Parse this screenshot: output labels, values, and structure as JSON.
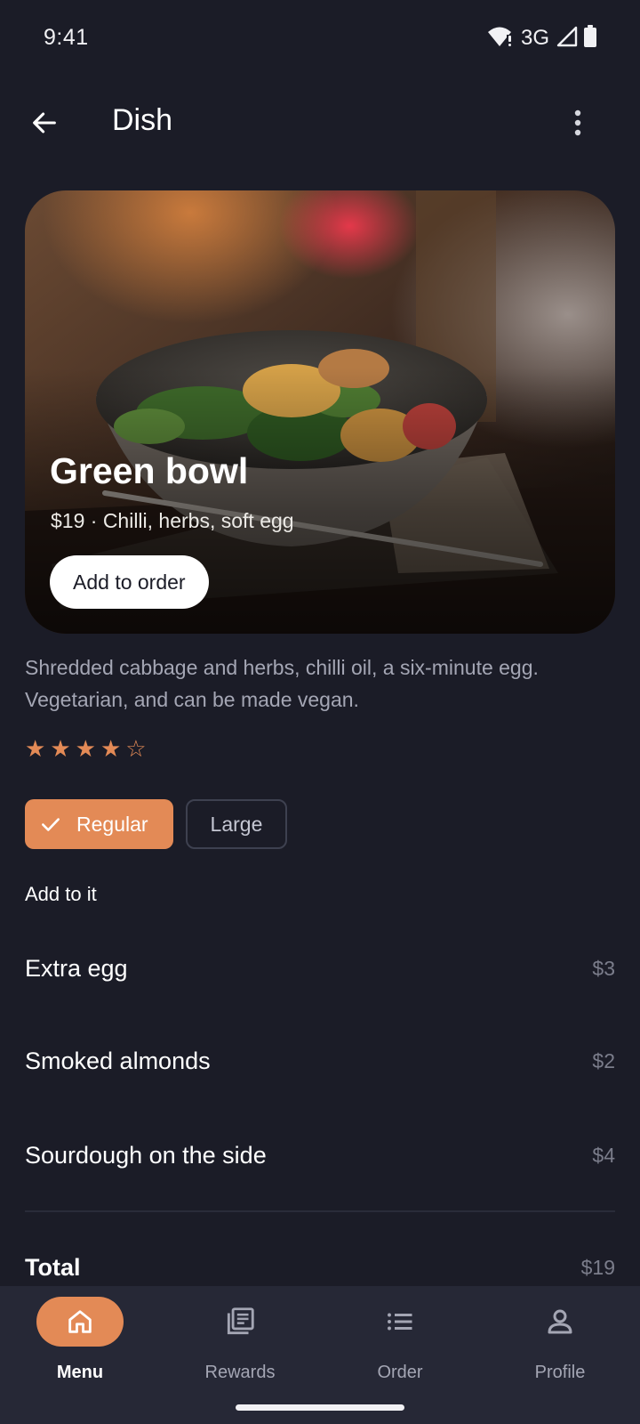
{
  "status_bar": {
    "time": "9:41",
    "network": "3G",
    "icons": [
      "wifi-alert-icon",
      "signal-icon",
      "battery-icon"
    ]
  },
  "app_bar": {
    "title": "Dish",
    "back_icon": "arrow-left-icon",
    "more_icon": "more-vert-icon"
  },
  "dish": {
    "name": "Green bowl",
    "meta": "$19 · Chilli, herbs, soft egg",
    "add_button": "Add to order",
    "description": "Shredded cabbage and herbs, chilli oil, a six-minute egg. Vegetarian, and can be made vegan.",
    "rating": 4,
    "rating_max": 5
  },
  "sizes": {
    "options": [
      {
        "label": "Regular",
        "selected": true
      },
      {
        "label": "Large",
        "selected": false
      }
    ]
  },
  "addons": {
    "section_title": "Add to it",
    "items": [
      {
        "name": "Extra egg",
        "price": "$3"
      },
      {
        "name": "Smoked almonds",
        "price": "$2"
      },
      {
        "name": "Sourdough on the side",
        "price": "$4"
      }
    ]
  },
  "total": {
    "label": "Total",
    "value": "$19"
  },
  "bottom_nav": {
    "items": [
      {
        "label": "Menu",
        "icon": "home-icon",
        "active": true
      },
      {
        "label": "Rewards",
        "icon": "rewards-icon",
        "active": false
      },
      {
        "label": "Order",
        "icon": "list-icon",
        "active": false
      },
      {
        "label": "Profile",
        "icon": "person-icon",
        "active": false
      }
    ]
  },
  "colors": {
    "background": "#1b1c27",
    "accent": "#e38a56",
    "nav_background": "#262836",
    "muted_text": "#a4a6b4"
  }
}
